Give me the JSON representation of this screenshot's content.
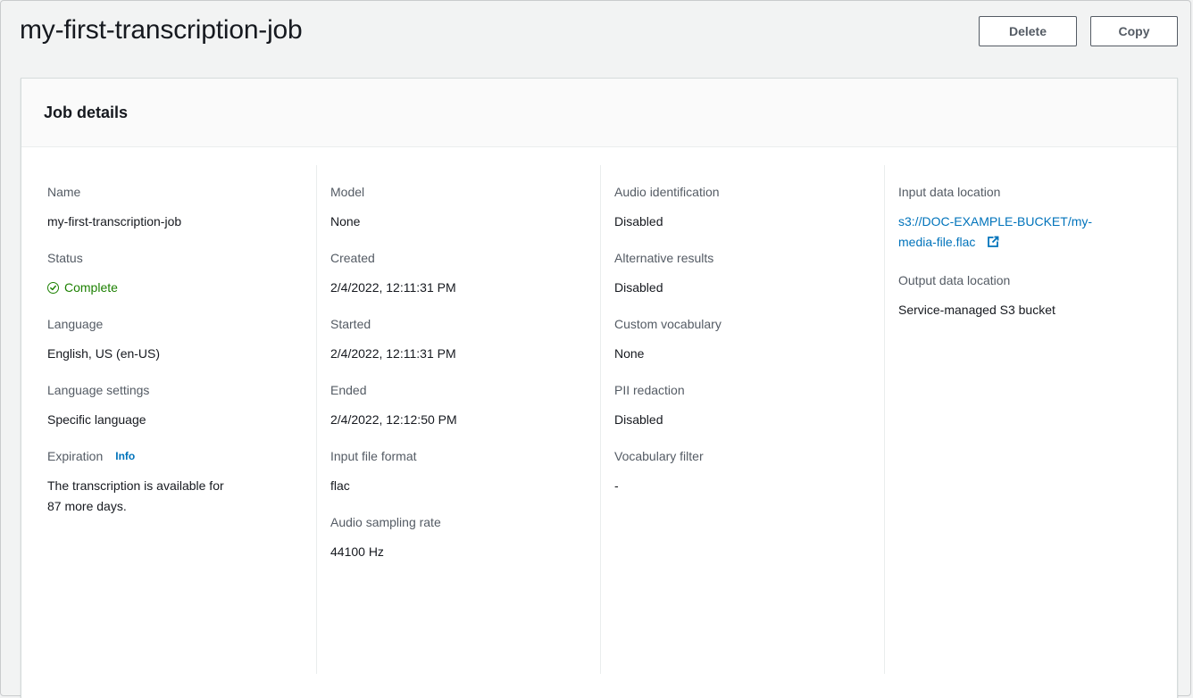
{
  "page": {
    "title": "my-first-transcription-job",
    "delete_label": "Delete",
    "copy_label": "Copy"
  },
  "card": {
    "title": "Job details"
  },
  "col1": {
    "name_label": "Name",
    "name_value": "my-first-transcription-job",
    "status_label": "Status",
    "status_value": "Complete",
    "status_icon": "check-circle-icon",
    "language_label": "Language",
    "language_value": "English, US (en-US)",
    "language_settings_label": "Language settings",
    "language_settings_value": "Specific language",
    "expiration_label": "Expiration",
    "expiration_info": "Info",
    "expiration_value_line1": "The transcription is available for",
    "expiration_value_line2": "87 more days."
  },
  "col2": {
    "model_label": "Model",
    "model_value": "None",
    "created_label": "Created",
    "created_value": "2/4/2022, 12:11:31 PM",
    "started_label": "Started",
    "started_value": "2/4/2022, 12:11:31 PM",
    "ended_label": "Ended",
    "ended_value": "2/4/2022, 12:12:50 PM",
    "input_format_label": "Input file format",
    "input_format_value": "flac",
    "sampling_rate_label": "Audio sampling rate",
    "sampling_rate_value": "44100 Hz"
  },
  "col3": {
    "audio_id_label": "Audio identification",
    "audio_id_value": "Disabled",
    "alt_results_label": "Alternative results",
    "alt_results_value": "Disabled",
    "custom_vocab_label": "Custom vocabulary",
    "custom_vocab_value": "None",
    "pii_label": "PII redaction",
    "pii_value": "Disabled",
    "vocab_filter_label": "Vocabulary filter",
    "vocab_filter_value": "-"
  },
  "col4": {
    "input_location_label": "Input data location",
    "input_location_line1": "s3://DOC-EXAMPLE-BUCKET/my-",
    "input_location_line2": "media-file.flac",
    "input_location_icon": "external-link-icon",
    "output_location_label": "Output data location",
    "output_location_value": "Service-managed S3 bucket"
  },
  "colors": {
    "link": "#0073bb",
    "success": "#1d8102",
    "text": "#16191f",
    "label": "#545b64"
  }
}
